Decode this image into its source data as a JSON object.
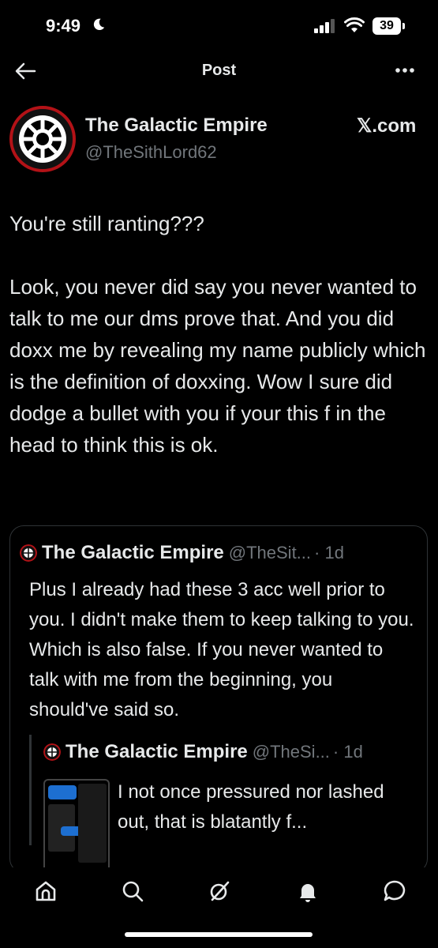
{
  "status_bar": {
    "time": "9:49",
    "battery": "39"
  },
  "header": {
    "title": "Post"
  },
  "post": {
    "author_name": "The Galactic Empire",
    "handle": "@TheSithLord62",
    "source": "𝕏.com",
    "text": "You're still ranting???\n\nLook, you never did say you never wanted to talk to me our dms prove that. And you did doxx me by revealing my name publicly which is the definition of doxxing. Wow I sure did dodge a bullet with you if your this f in the head to think this is ok."
  },
  "quote": {
    "author_name": "The Galactic Empire",
    "handle": "@TheSit...",
    "time": "· 1d",
    "text": "Plus I already had these 3 acc well prior to you. I didn't make them to keep talking to you. Which is also false. If you never wanted to talk with me from the beginning, you should've said so.",
    "nested": {
      "author_name": "The Galactic Empire",
      "handle": "@TheSi...",
      "time": "· 1d",
      "text": "I not once pressured nor lashed out, that is blatantly f..."
    }
  },
  "nav": {
    "items": [
      "home-icon",
      "search-icon",
      "grok-icon",
      "notifications-icon",
      "messages-icon"
    ]
  },
  "colors": {
    "background": "#000000",
    "text": "#e7e9ea",
    "muted": "#71767b",
    "border": "#2f3336",
    "emblem_red": "#b31217"
  }
}
